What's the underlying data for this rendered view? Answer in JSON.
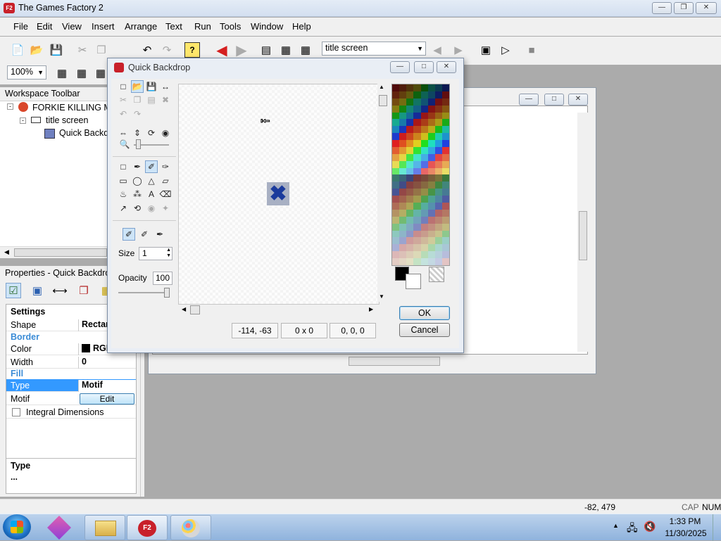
{
  "app": {
    "title": "The Games Factory 2",
    "logo_text": "F2"
  },
  "menu": [
    "File",
    "Edit",
    "View",
    "Insert",
    "Arrange",
    "Text",
    "Run",
    "Tools",
    "Window",
    "Help"
  ],
  "toolbar": {
    "frame_select": "title screen",
    "zoom_select": "100%"
  },
  "workspace": {
    "title": "Workspace Toolbar",
    "tree": [
      "FORKIE KILLING MA",
      "title screen",
      "Quick Backd"
    ]
  },
  "properties": {
    "title": "Properties - Quick Backdrop",
    "section": "Settings",
    "shape_label": "Shape",
    "shape_value": "Rectan",
    "border_label": "Border",
    "color_label": "Color",
    "color_value": "RGB",
    "width_label": "Width",
    "width_value": "0",
    "fill_label": "Fill",
    "type_label": "Type",
    "type_value": "Motif",
    "motif_label": "Motif",
    "motif_button": "Edit",
    "integral_label": "Integral Dimensions",
    "help_title": "Type",
    "help_text": "..."
  },
  "dialog": {
    "title": "Quick Backdrop",
    "size_label": "Size",
    "size_value": "1",
    "opacity_label": "Opacity",
    "opacity_value": "100",
    "status_coords": "-114, -63",
    "status_size": "0 x 0",
    "status_rgb": "0, 0, 0",
    "ok": "OK",
    "cancel": "Cancel"
  },
  "statusbar": {
    "coords": "-82, 479",
    "cap": "CAP",
    "num": "NUM"
  },
  "taskbar": {
    "time": "1:33 PM",
    "date": "11/30/2025"
  },
  "colors": {
    "accent": "#3399ff",
    "selection": "#3399ff",
    "close_x": "#1a3a9c"
  }
}
